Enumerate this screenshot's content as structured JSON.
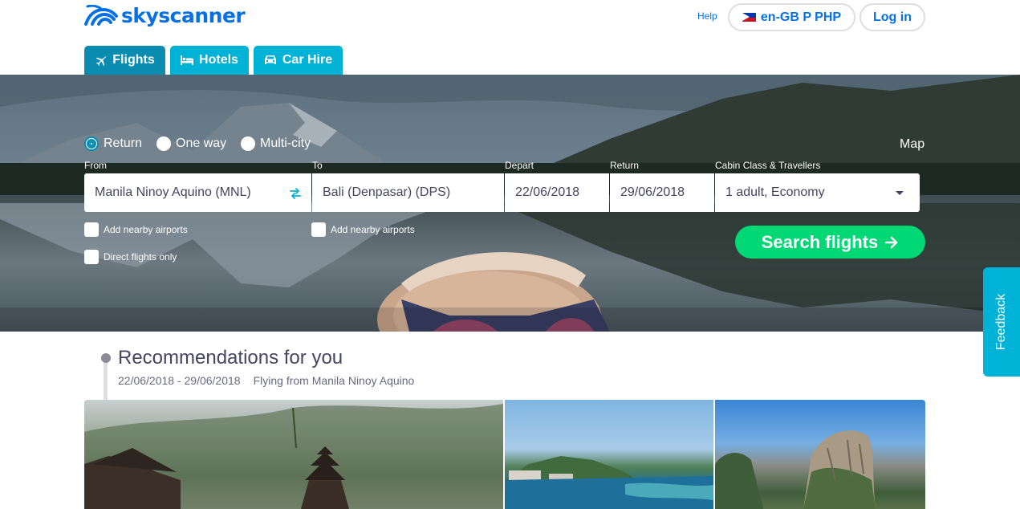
{
  "header": {
    "logo_text": "skyscanner",
    "help": "Help",
    "locale": "en-GB P PHP",
    "login": "Log in"
  },
  "tabs": [
    {
      "label": "Flights",
      "icon": "plane-icon",
      "active": true
    },
    {
      "label": "Hotels",
      "icon": "bed-icon",
      "active": false
    },
    {
      "label": "Car Hire",
      "icon": "car-icon",
      "active": false
    }
  ],
  "search": {
    "trip_types": [
      {
        "label": "Return",
        "selected": true
      },
      {
        "label": "One way",
        "selected": false
      },
      {
        "label": "Multi-city",
        "selected": false
      }
    ],
    "map_link": "Map",
    "from": {
      "label": "From",
      "value": "Manila Ninoy Aquino (MNL)"
    },
    "to": {
      "label": "To",
      "value": "Bali (Denpasar) (DPS)"
    },
    "depart": {
      "label": "Depart",
      "value": "22/06/2018"
    },
    "return": {
      "label": "Return",
      "value": "29/06/2018"
    },
    "cabin": {
      "label": "Cabin Class & Travellers",
      "value": "1 adult, Economy"
    },
    "nearby_from": "Add nearby airports",
    "nearby_to": "Add nearby airports",
    "direct_only": "Direct flights only",
    "submit": "Search flights"
  },
  "feedback": "Feedback",
  "recommendations": {
    "title": "Recommendations for you",
    "dates": "22/06/2018 - 29/06/2018",
    "origin": "Flying from Manila Ninoy Aquino"
  },
  "colors": {
    "brand_blue": "#0770e3",
    "tab_active": "#0a8cb0",
    "tab": "#00b2d6",
    "search_green": "#00d775"
  }
}
